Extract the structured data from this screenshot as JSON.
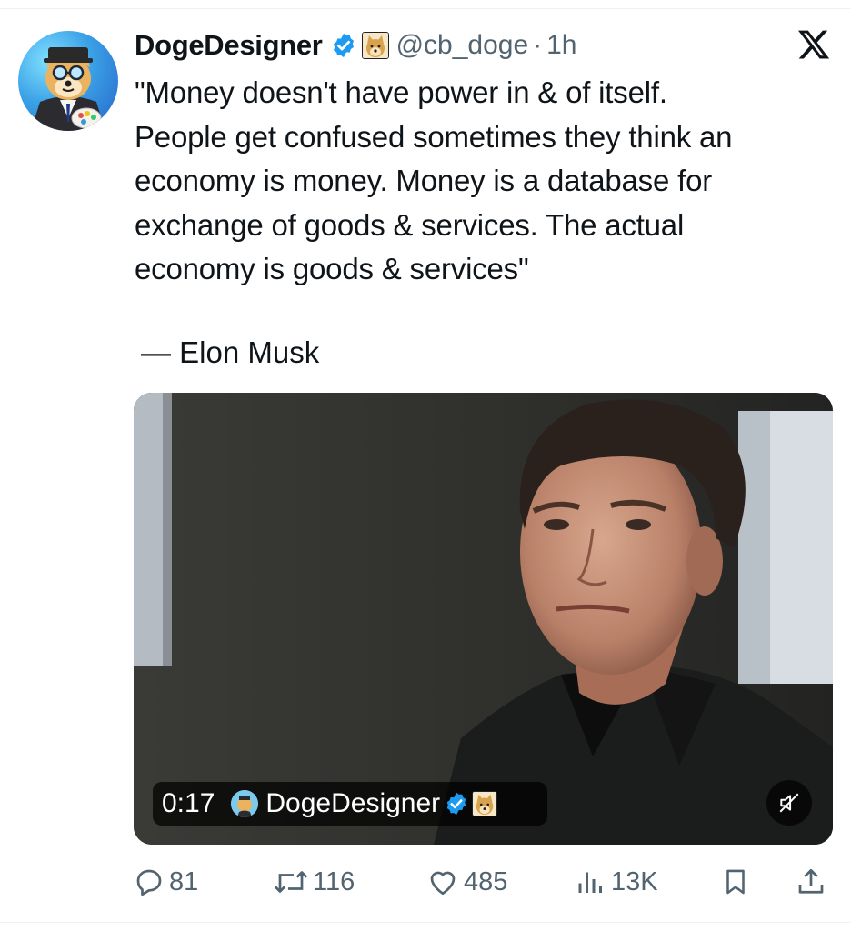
{
  "tweet": {
    "author": {
      "display_name": "DogeDesigner",
      "handle": "@cb_doge",
      "verified": true,
      "avatar_icon": "doge-painter-avatar"
    },
    "separator": "·",
    "timestamp": "1h",
    "platform_icon": "x-logo-icon",
    "text_lines": [
      "\"Money doesn't have power in & of itself.",
      "People get confused sometimes they think an",
      "economy is money. Money is a database for",
      "exchange of goods & services. The actual",
      "economy is goods & services\""
    ],
    "attribution": "— Elon Musk",
    "media": {
      "type": "video",
      "duration": "0:17",
      "author": "DogeDesigner",
      "muted": true
    },
    "stats": {
      "replies": "81",
      "reposts": "116",
      "likes": "485",
      "views": "13K"
    }
  },
  "colors": {
    "text": "#0f1419",
    "secondary": "#536471",
    "verified_blue": "#1d9bf0",
    "background": "#ffffff"
  }
}
